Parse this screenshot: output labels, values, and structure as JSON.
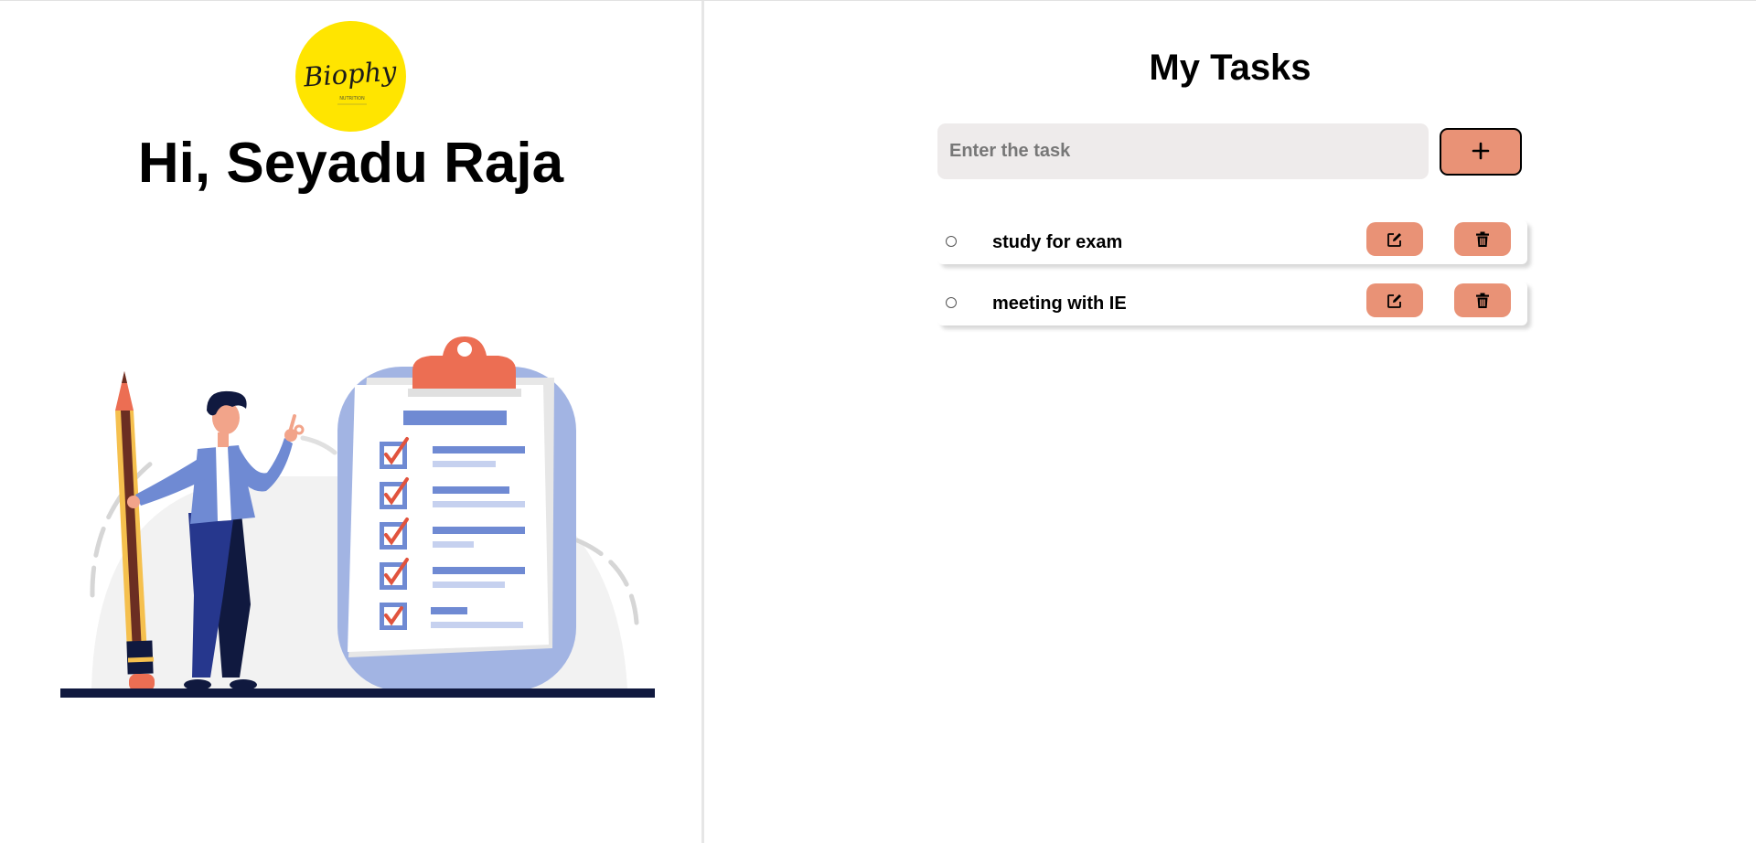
{
  "profile": {
    "logo_text": "Biophy",
    "logo_subtext": "NUTRITION",
    "greeting": "Hi, Seyadu Raja",
    "logo_color": "#ffe500"
  },
  "illustration": {
    "name": "task-checklist-illustration",
    "icon": "person-with-pencil-and-clipboard"
  },
  "tasks_panel": {
    "title": "My Tasks",
    "input": {
      "placeholder": "Enter the task",
      "value": ""
    },
    "add_button_label": "+",
    "accent_color": "#e99276",
    "tasks": [
      {
        "text": "study for exam",
        "completed": false
      },
      {
        "text": "meeting with IE",
        "completed": false
      }
    ],
    "edit_icon": "edit-icon",
    "delete_icon": "trash-icon"
  }
}
